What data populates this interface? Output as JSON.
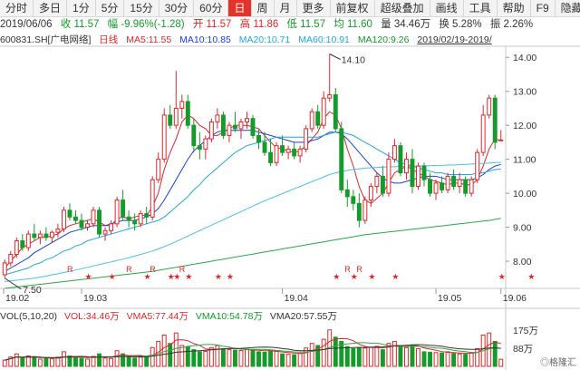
{
  "toolbar": {
    "tabs": [
      "分时",
      "多日",
      "1分",
      "5分",
      "15分",
      "30分",
      "60分",
      "日",
      "周",
      "月",
      "更多",
      "前复权",
      "超级叠加",
      "画线",
      "工具",
      "帮助",
      "F9",
      "隐藏"
    ],
    "active": "日"
  },
  "quote": {
    "date": "2019/06/06",
    "close": "收 11.57",
    "change": "幅 -9.96%(-1.28)",
    "open": "开 11.57",
    "high": "高 11.86",
    "low": "低 11.57",
    "avg": "均 11.60",
    "volume": "量 34.46万",
    "turnover": "换 5.28%",
    "amplitude": "振 2.26%"
  },
  "main_legend": {
    "code": "600831.SH",
    "name": "[广电网络]",
    "period": "日线",
    "ma5": "MA5:11.55",
    "ma10": "MA10:10.85",
    "ma20": "MA20:10.71",
    "ma60": "MA60:10.91",
    "ma120": "MA120:9.26",
    "range": "2019/02/19-2019/"
  },
  "volume_legend": {
    "label": "VOL(5,10,20)",
    "vol": "VOL:34.46万",
    "vma5": "VMA5:77.44万",
    "vma10": "VMA10:54.78万",
    "vma20": "VMA20:57.55万"
  },
  "annotations": {
    "high_label": "14.10",
    "low_label": "7.50"
  },
  "colors": {
    "up": "#e0272a",
    "down": "#159b2b",
    "ma5": "#e0272a",
    "ma10": "#1b3fd6",
    "ma20": "#1fa6e8",
    "ma60": "#47c2e8",
    "ma120": "#2aa843"
  },
  "watermark": "◎格隆汇",
  "chart_data": {
    "type": "candlestick",
    "x_ticks": [
      "19.02",
      "19.03",
      "19.04",
      "19.05",
      "19.06"
    ],
    "y_ticks": [
      8.0,
      9.0,
      10.0,
      11.0,
      12.0,
      13.0,
      14.0
    ],
    "ylim": [
      7.2,
      14.3
    ],
    "volume_ticks": [
      "175万",
      "88万"
    ],
    "volume_ylim": [
      0,
      200
    ],
    "ohlc": [
      [
        7.6,
        8.05,
        7.5,
        7.95
      ],
      [
        7.95,
        8.3,
        7.85,
        8.2
      ],
      [
        8.2,
        8.7,
        8.1,
        8.6
      ],
      [
        8.6,
        8.8,
        8.3,
        8.4
      ],
      [
        8.4,
        8.9,
        8.3,
        8.8
      ],
      [
        8.8,
        9.1,
        8.6,
        8.7
      ],
      [
        8.7,
        8.9,
        8.5,
        8.8
      ],
      [
        8.8,
        9.0,
        8.6,
        8.7
      ],
      [
        8.7,
        8.9,
        8.55,
        8.85
      ],
      [
        8.85,
        9.1,
        8.7,
        8.95
      ],
      [
        8.95,
        9.6,
        8.85,
        9.5
      ],
      [
        9.5,
        9.7,
        9.2,
        9.3
      ],
      [
        9.3,
        9.5,
        9.1,
        9.2
      ],
      [
        9.2,
        9.4,
        8.9,
        9.0
      ],
      [
        9.0,
        9.2,
        8.9,
        9.1
      ],
      [
        9.1,
        9.6,
        9.0,
        9.5
      ],
      [
        9.5,
        9.6,
        8.7,
        8.8
      ],
      [
        8.8,
        9.0,
        8.6,
        8.9
      ],
      [
        8.9,
        9.2,
        8.8,
        9.1
      ],
      [
        9.1,
        9.9,
        9.0,
        9.8
      ],
      [
        9.8,
        10.1,
        9.2,
        9.3
      ],
      [
        9.3,
        9.5,
        9.0,
        9.2
      ],
      [
        9.2,
        9.4,
        8.9,
        9.1
      ],
      [
        9.1,
        9.5,
        9.0,
        9.4
      ],
      [
        9.4,
        9.6,
        9.1,
        9.3
      ],
      [
        9.3,
        10.5,
        9.2,
        10.4
      ],
      [
        10.4,
        11.2,
        10.3,
        11.0
      ],
      [
        11.0,
        12.5,
        10.9,
        12.3
      ],
      [
        12.3,
        12.6,
        11.9,
        12.0
      ],
      [
        12.0,
        13.6,
        11.9,
        12.5
      ],
      [
        12.5,
        12.9,
        12.2,
        12.7
      ],
      [
        12.7,
        12.9,
        11.9,
        12.0
      ],
      [
        12.0,
        12.2,
        11.2,
        11.4
      ],
      [
        11.4,
        11.8,
        11.0,
        11.3
      ],
      [
        11.3,
        11.7,
        11.0,
        11.6
      ],
      [
        11.6,
        12.2,
        11.5,
        12.1
      ],
      [
        12.1,
        12.5,
        11.9,
        12.3
      ],
      [
        12.3,
        12.4,
        11.6,
        11.7
      ],
      [
        11.7,
        12.1,
        11.5,
        12.0
      ],
      [
        12.0,
        12.4,
        11.8,
        11.9
      ],
      [
        11.9,
        12.2,
        11.6,
        12.1
      ],
      [
        12.1,
        12.4,
        11.9,
        12.2
      ],
      [
        12.2,
        12.3,
        11.6,
        11.7
      ],
      [
        11.7,
        11.9,
        11.3,
        11.5
      ],
      [
        11.5,
        11.8,
        11.1,
        11.2
      ],
      [
        11.2,
        11.6,
        10.8,
        10.9
      ],
      [
        10.9,
        11.5,
        10.8,
        11.4
      ],
      [
        11.4,
        11.7,
        11.1,
        11.2
      ],
      [
        11.2,
        11.4,
        11.0,
        11.3
      ],
      [
        11.3,
        11.5,
        11.0,
        11.1
      ],
      [
        11.1,
        11.4,
        10.9,
        11.3
      ],
      [
        11.3,
        12.0,
        11.2,
        11.9
      ],
      [
        11.9,
        12.5,
        11.8,
        12.4
      ],
      [
        12.4,
        12.6,
        11.9,
        12.0
      ],
      [
        12.0,
        13.0,
        11.9,
        12.8
      ],
      [
        12.8,
        14.1,
        12.7,
        12.9
      ],
      [
        12.9,
        13.1,
        11.8,
        11.9
      ],
      [
        11.9,
        12.1,
        10.0,
        10.1
      ],
      [
        10.1,
        10.4,
        9.6,
        9.9
      ],
      [
        9.9,
        10.1,
        9.5,
        9.7
      ],
      [
        9.7,
        10.0,
        9.0,
        9.2
      ],
      [
        9.2,
        9.9,
        9.1,
        9.8
      ],
      [
        9.8,
        10.3,
        9.6,
        10.2
      ],
      [
        10.2,
        10.6,
        10.0,
        10.5
      ],
      [
        10.5,
        10.8,
        9.9,
        10.0
      ],
      [
        10.0,
        11.2,
        9.9,
        11.0
      ],
      [
        11.0,
        11.6,
        10.9,
        11.4
      ],
      [
        11.4,
        11.5,
        10.5,
        10.6
      ],
      [
        10.6,
        11.2,
        10.4,
        11.0
      ],
      [
        11.0,
        11.3,
        10.0,
        10.2
      ],
      [
        10.2,
        10.9,
        10.1,
        10.8
      ],
      [
        10.8,
        10.9,
        10.2,
        10.4
      ],
      [
        10.4,
        10.6,
        9.9,
        10.0
      ],
      [
        10.0,
        10.4,
        9.8,
        10.3
      ],
      [
        10.3,
        10.5,
        10.0,
        10.1
      ],
      [
        10.1,
        10.6,
        10.0,
        10.5
      ],
      [
        10.5,
        10.7,
        10.1,
        10.2
      ],
      [
        10.2,
        10.6,
        10.0,
        10.4
      ],
      [
        10.4,
        10.5,
        9.9,
        10.0
      ],
      [
        10.0,
        10.5,
        9.9,
        10.4
      ],
      [
        10.4,
        11.3,
        10.3,
        11.2
      ],
      [
        11.2,
        12.6,
        11.1,
        12.3
      ],
      [
        12.3,
        12.9,
        12.2,
        12.8
      ],
      [
        12.8,
        12.9,
        11.3,
        11.5
      ],
      [
        11.57,
        11.86,
        11.57,
        11.57
      ]
    ],
    "volume": [
      30,
      45,
      60,
      40,
      50,
      42,
      35,
      38,
      36,
      44,
      70,
      50,
      40,
      38,
      35,
      48,
      60,
      40,
      38,
      75,
      60,
      45,
      40,
      44,
      46,
      90,
      120,
      150,
      110,
      160,
      100,
      95,
      80,
      70,
      72,
      90,
      100,
      85,
      80,
      78,
      76,
      82,
      78,
      70,
      68,
      75,
      72,
      60,
      58,
      56,
      62,
      88,
      110,
      100,
      130,
      175,
      140,
      120,
      95,
      85,
      90,
      88,
      92,
      96,
      80,
      110,
      120,
      95,
      90,
      100,
      85,
      70,
      68,
      66,
      64,
      70,
      62,
      60,
      58,
      66,
      85,
      150,
      160,
      120,
      34
    ],
    "ma_lines": {
      "MA5": [
        7.8,
        8.0,
        8.2,
        8.4,
        8.5,
        8.6,
        8.7,
        8.7,
        8.75,
        8.8,
        8.95,
        9.05,
        9.1,
        9.15,
        9.2,
        9.25,
        9.15,
        9.05,
        9.05,
        9.25,
        9.3,
        9.25,
        9.3,
        9.35,
        9.35,
        9.6,
        10.0,
        10.7,
        11.2,
        11.6,
        12.1,
        12.3,
        12.2,
        12.0,
        11.9,
        11.7,
        11.7,
        11.8,
        11.9,
        12.0,
        12.0,
        12.0,
        11.95,
        11.9,
        11.7,
        11.5,
        11.35,
        11.3,
        11.25,
        11.2,
        11.25,
        11.4,
        11.6,
        11.8,
        12.2,
        12.4,
        12.3,
        11.9,
        11.3,
        10.8,
        10.2,
        9.8,
        9.7,
        9.85,
        10.0,
        10.3,
        10.6,
        10.7,
        10.8,
        10.7,
        10.6,
        10.5,
        10.4,
        10.35,
        10.3,
        10.25,
        10.3,
        10.3,
        10.25,
        10.25,
        10.4,
        10.8,
        11.3,
        11.6,
        11.55
      ],
      "MA10": [
        7.7,
        7.8,
        7.9,
        8.0,
        8.1,
        8.25,
        8.35,
        8.45,
        8.55,
        8.65,
        8.75,
        8.85,
        8.9,
        8.95,
        9.0,
        9.05,
        9.05,
        9.05,
        9.1,
        9.15,
        9.2,
        9.2,
        9.2,
        9.25,
        9.3,
        9.4,
        9.55,
        9.8,
        10.1,
        10.4,
        10.7,
        11.0,
        11.25,
        11.4,
        11.55,
        11.7,
        11.8,
        11.85,
        11.85,
        11.85,
        11.85,
        11.85,
        11.85,
        11.8,
        11.75,
        11.7,
        11.65,
        11.6,
        11.55,
        11.5,
        11.5,
        11.5,
        11.55,
        11.6,
        11.7,
        11.8,
        11.8,
        11.75,
        11.6,
        11.4,
        11.2,
        11.0,
        10.8,
        10.6,
        10.45,
        10.35,
        10.3,
        10.3,
        10.35,
        10.4,
        10.45,
        10.5,
        10.5,
        10.5,
        10.45,
        10.4,
        10.4,
        10.4,
        10.4,
        10.4,
        10.45,
        10.55,
        10.7,
        10.8,
        10.85
      ],
      "MA20": [
        7.6,
        7.65,
        7.7,
        7.75,
        7.8,
        7.9,
        7.95,
        8.05,
        8.1,
        8.2,
        8.3,
        8.35,
        8.45,
        8.5,
        8.6,
        8.65,
        8.7,
        8.75,
        8.8,
        8.85,
        8.9,
        8.95,
        9.0,
        9.05,
        9.1,
        9.15,
        9.2,
        9.3,
        9.45,
        9.6,
        9.75,
        9.9,
        10.1,
        10.25,
        10.45,
        10.6,
        10.75,
        10.9,
        11.05,
        11.2,
        11.3,
        11.4,
        11.45,
        11.5,
        11.55,
        11.6,
        11.65,
        11.65,
        11.65,
        11.65,
        11.65,
        11.65,
        11.65,
        11.65,
        11.7,
        11.75,
        11.8,
        11.8,
        11.75,
        11.7,
        11.6,
        11.5,
        11.4,
        11.3,
        11.2,
        11.1,
        11.0,
        10.9,
        10.85,
        10.8,
        10.75,
        10.7,
        10.65,
        10.6,
        10.6,
        10.55,
        10.55,
        10.55,
        10.55,
        10.55,
        10.6,
        10.6,
        10.65,
        10.7,
        10.71
      ],
      "MA60": [
        7.4,
        7.42,
        7.44,
        7.46,
        7.48,
        7.5,
        7.53,
        7.56,
        7.6,
        7.63,
        7.67,
        7.7,
        7.74,
        7.78,
        7.82,
        7.86,
        7.9,
        7.94,
        7.98,
        8.02,
        8.06,
        8.1,
        8.15,
        8.2,
        8.25,
        8.3,
        8.36,
        8.43,
        8.5,
        8.58,
        8.66,
        8.74,
        8.82,
        8.9,
        8.98,
        9.06,
        9.14,
        9.22,
        9.3,
        9.38,
        9.46,
        9.54,
        9.62,
        9.7,
        9.78,
        9.85,
        9.92,
        9.99,
        10.06,
        10.13,
        10.2,
        10.27,
        10.34,
        10.41,
        10.48,
        10.55,
        10.6,
        10.64,
        10.67,
        10.7,
        10.72,
        10.74,
        10.75,
        10.76,
        10.77,
        10.78,
        10.78,
        10.79,
        10.8,
        10.8,
        10.8,
        10.81,
        10.81,
        10.82,
        10.82,
        10.83,
        10.83,
        10.84,
        10.85,
        10.86,
        10.87,
        10.88,
        10.89,
        10.9,
        10.91
      ],
      "MA120": [
        7.2,
        7.22,
        7.24,
        7.26,
        7.28,
        7.3,
        7.32,
        7.34,
        7.36,
        7.38,
        7.4,
        7.42,
        7.44,
        7.46,
        7.48,
        7.5,
        7.52,
        7.54,
        7.56,
        7.58,
        7.6,
        7.62,
        7.64,
        7.66,
        7.68,
        7.7,
        7.73,
        7.76,
        7.79,
        7.82,
        7.85,
        7.88,
        7.91,
        7.94,
        7.97,
        8.0,
        8.03,
        8.06,
        8.09,
        8.12,
        8.15,
        8.18,
        8.21,
        8.24,
        8.27,
        8.3,
        8.33,
        8.36,
        8.39,
        8.42,
        8.45,
        8.48,
        8.51,
        8.54,
        8.57,
        8.6,
        8.63,
        8.66,
        8.69,
        8.72,
        8.75,
        8.78,
        8.8,
        8.82,
        8.84,
        8.86,
        8.88,
        8.9,
        8.92,
        8.94,
        8.96,
        8.98,
        9.0,
        9.02,
        9.04,
        9.06,
        9.08,
        9.1,
        9.12,
        9.14,
        9.16,
        9.18,
        9.2,
        9.23,
        9.26
      ]
    },
    "r_markers": [
      11,
      21,
      25,
      30,
      58,
      60
    ],
    "star_markers": [
      14,
      18,
      24,
      28,
      29,
      31,
      36,
      38,
      56,
      59,
      62,
      66,
      84,
      89
    ]
  }
}
